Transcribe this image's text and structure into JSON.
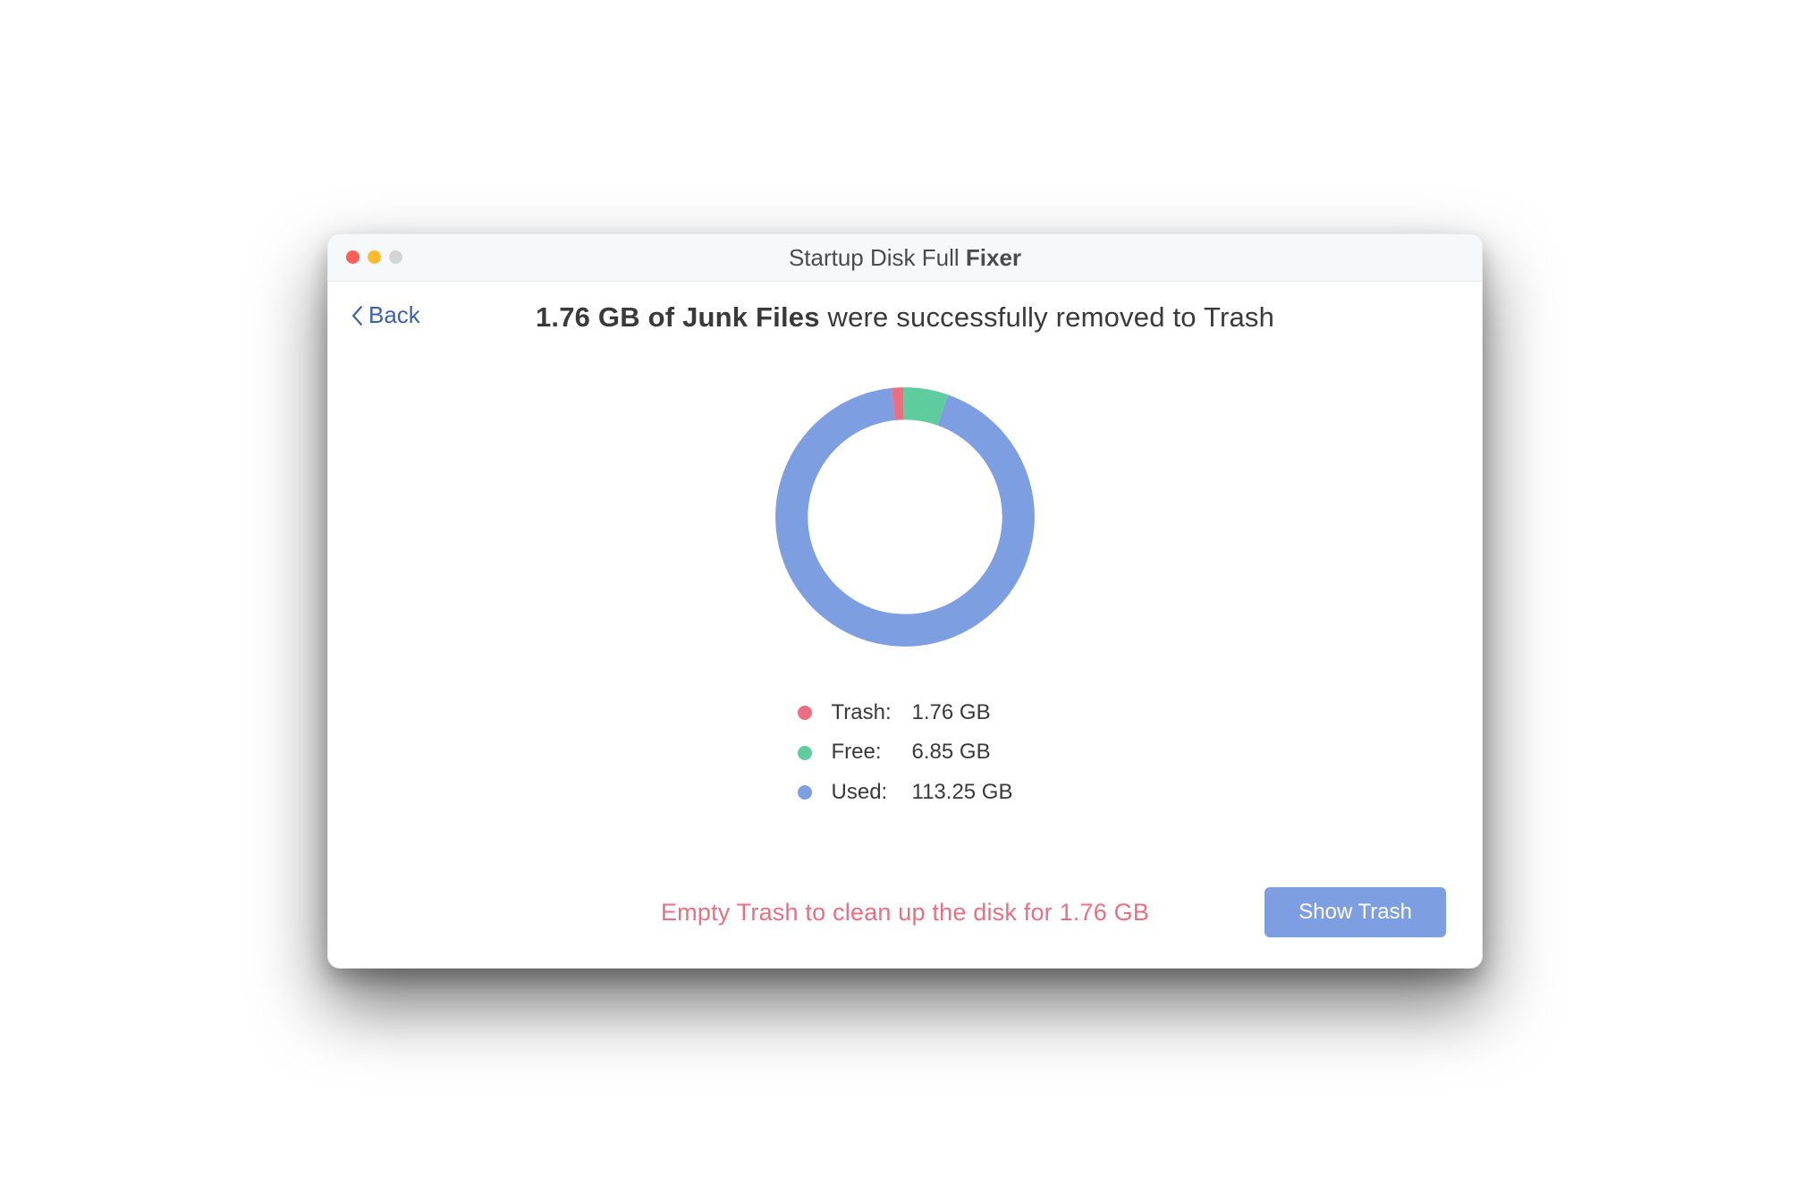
{
  "window_title_prefix": "Startup Disk Full ",
  "window_title_bold": "Fixer",
  "back_label": "Back",
  "headline_bold": "1.76 GB of Junk Files",
  "headline_rest": " were successfully removed to Trash",
  "legend": {
    "trash": {
      "label": "Trash:",
      "value": "1.76 GB",
      "color": "#ec6e81"
    },
    "free": {
      "label": "Free:",
      "value": "6.85 GB",
      "color": "#5fcc9d"
    },
    "used": {
      "label": "Used:",
      "value": "113.25 GB",
      "color": "#7d9fe2"
    }
  },
  "hint_text": "Empty Trash to clean up the disk for 1.76 GB",
  "show_trash_label": "Show Trash",
  "chart_data": {
    "type": "pie",
    "title": "",
    "series": [
      {
        "name": "Trash",
        "value": 1.76,
        "color": "#ec6e81"
      },
      {
        "name": "Free",
        "value": 6.85,
        "color": "#5fcc9d"
      },
      {
        "name": "Used",
        "value": 113.25,
        "color": "#7d9fe2"
      }
    ],
    "donut": true,
    "start_angle": -6
  }
}
